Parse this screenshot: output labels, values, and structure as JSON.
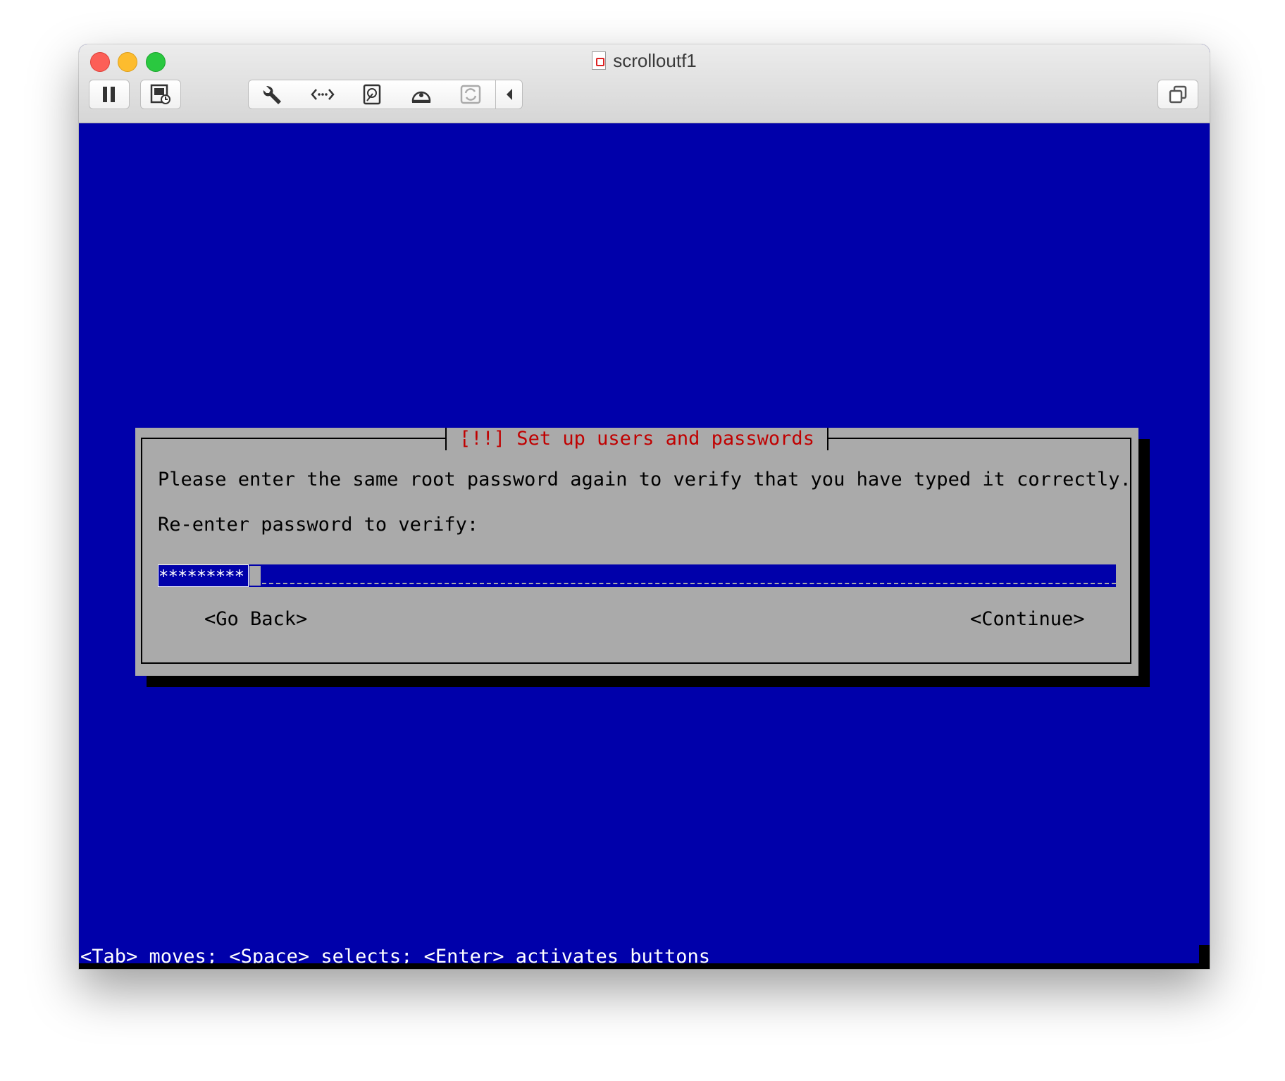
{
  "window": {
    "title": "scrolloutf1"
  },
  "toolbar": {
    "items": [
      {
        "icon": "pause-icon"
      },
      {
        "icon": "snapshot-icon"
      },
      {
        "icon": "wrench-icon"
      },
      {
        "icon": "network-arrows-icon"
      },
      {
        "icon": "hard-disk-icon"
      },
      {
        "icon": "optical-disc-icon"
      },
      {
        "icon": "sync-icon"
      },
      {
        "icon": "chevron-left-icon"
      },
      {
        "icon": "fullscreen-icon"
      }
    ]
  },
  "installer": {
    "dialog_title": "[!!] Set up users and passwords",
    "message": "Please enter the same root password again to verify that you have typed it correctly.",
    "prompt": "Re-enter password to verify:",
    "password_mask": "*********",
    "go_back_label": "<Go Back>",
    "continue_label": "<Continue>",
    "status_line": "<Tab> moves; <Space> selects; <Enter> activates buttons"
  },
  "colors": {
    "console_background": "#0000aa",
    "dialog_background": "#aaaaaa",
    "dialog_title": "#c00000",
    "shadow": "#000000",
    "titlebar": "#e4e4e4"
  }
}
